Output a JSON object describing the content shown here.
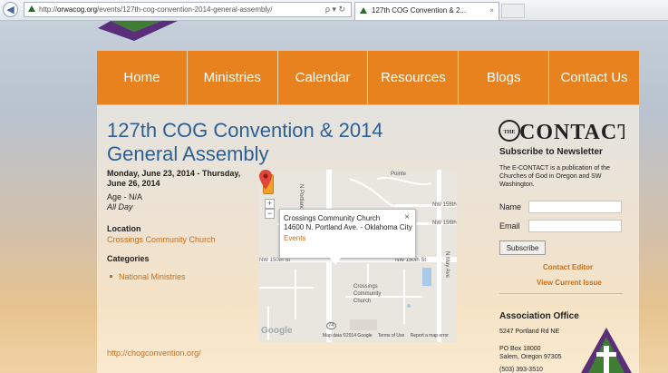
{
  "browser": {
    "url_prefix": "http://",
    "url_domain": "orwacog.org",
    "url_path": "/events/127th-cog-convention-2014-general-assembly/",
    "address_tools": "ρ ▾ ↻",
    "tab_title": "127th COG Convention & 2...",
    "tab_close": "×"
  },
  "nav": {
    "items": [
      "Home",
      "Ministries",
      "Calendar",
      "Resources",
      "Blogs",
      "Contact Us"
    ]
  },
  "event": {
    "title": "127th COG Convention & 2014 General Assembly",
    "date": "Monday, June 23, 2014 - Thursday, June 26, 2014",
    "age": "Age - N/A",
    "all_day": "All Day",
    "location_heading": "Location",
    "location_link": "Crossings Community Church",
    "categories_heading": "Categories",
    "category_item": "National Ministries",
    "website": "http://chogconvention.org/"
  },
  "map": {
    "popup_name": "Crossings Community Church",
    "popup_address": "14600 N. Portland Ave. - Oklahoma City",
    "popup_link": "Events",
    "popup_close": "×",
    "zoom_in": "+",
    "zoom_out": "−",
    "labels": {
      "pointe": "Pointe",
      "portland": "N Portland",
      "nw158": "NW 158th",
      "nw156": "NW 156th",
      "nw150_left": "NW 150th St",
      "nw150_right": "NW 150th St",
      "may": "N May Ave",
      "place_line1": "Crossings",
      "place_line2": "Community",
      "place_line3": "Church",
      "route": "74"
    },
    "google": "Google",
    "footer": [
      "Map data ©2014 Google",
      "Terms of Use",
      "Report a map error"
    ]
  },
  "sidebar": {
    "logo_text": "CONTACT",
    "logo_small": "THE",
    "subscribe_heading": "Subscribe to Newsletter",
    "description": "The E-CONTACT is a publication of the Churches of God in Oregon and SW Washington.",
    "name_label": "Name",
    "email_label": "Email",
    "subscribe_button": "Subscribe",
    "contact_editor": "Contact Editor",
    "view_issue": "View Current Issue",
    "association_heading": "Association Office",
    "street": "5247 Portland Rd NE",
    "po_box": "PO Box 18000",
    "city": "Salem, Oregon 97305",
    "phone": "(503) 393-3510"
  },
  "colors": {
    "nav": "#e8821f",
    "title": "#2d5f95",
    "link": "#c86e1b"
  }
}
